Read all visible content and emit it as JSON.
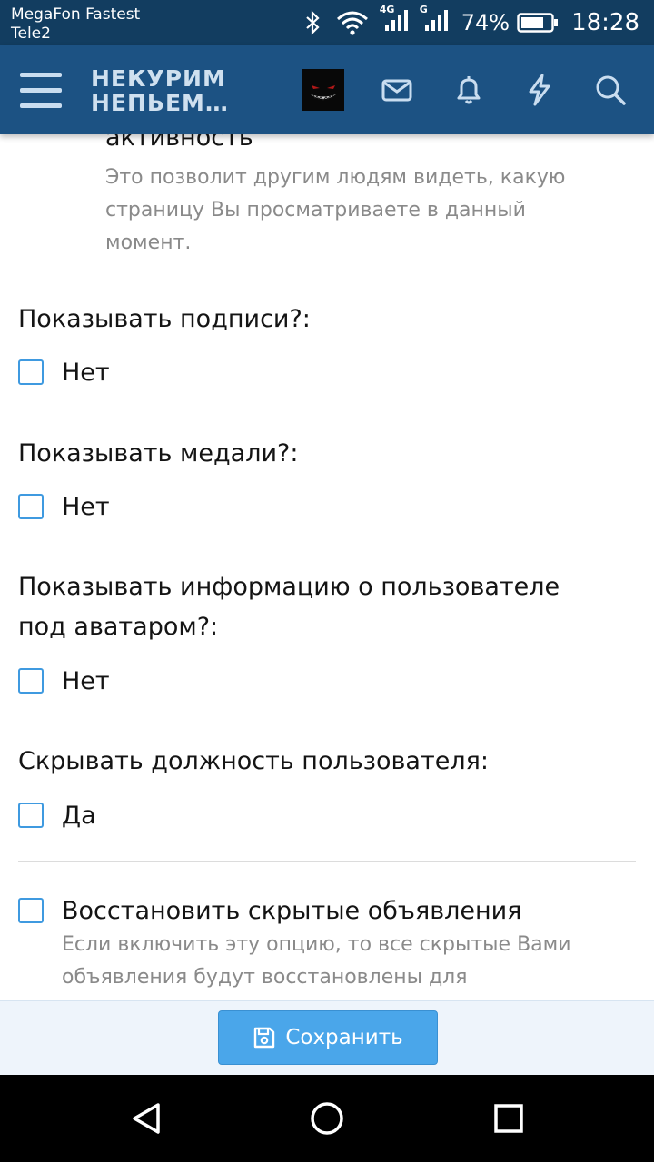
{
  "status_bar": {
    "carrier_primary": "MegaFon Fastest",
    "carrier_secondary": "Tele2",
    "network1": "4G",
    "network2": "G",
    "battery": "74%",
    "time": "18:28"
  },
  "header": {
    "logo_line1": "НЕКУРИМ",
    "logo_line2": "НЕПЬЕМ…",
    "icons": [
      "menu-icon",
      "avatar",
      "mail-icon",
      "bell-icon",
      "bolt-icon",
      "search-icon"
    ]
  },
  "settings": {
    "intro": {
      "title": "активность",
      "description": "Это позволит другим людям видеть, какую страницу Вы просматриваете в данный момент."
    },
    "items": [
      {
        "question": "Показывать подписи?:",
        "option": "Нет",
        "checked": false
      },
      {
        "question": "Показывать медали?:",
        "option": "Нет",
        "checked": false
      },
      {
        "question_line1": "Показывать информацию о пользователе",
        "question_line2": "под аватаром?:",
        "option": "Нет",
        "checked": false
      },
      {
        "question": "Скрывать должность пользователя:",
        "option": "Да",
        "checked": false
      }
    ],
    "restore": {
      "label": "Восстановить скрытые объявления",
      "description": "Если включить эту опцию, то все скрытые Вами объявления будут восстановлены для",
      "checked": false
    }
  },
  "footer": {
    "save_label": "Сохранить"
  },
  "colors": {
    "header_bg": "#1c5283",
    "status_bg": "#123d60",
    "accent": "#4aa6ea",
    "checkbox_border": "#3f9ae0"
  }
}
